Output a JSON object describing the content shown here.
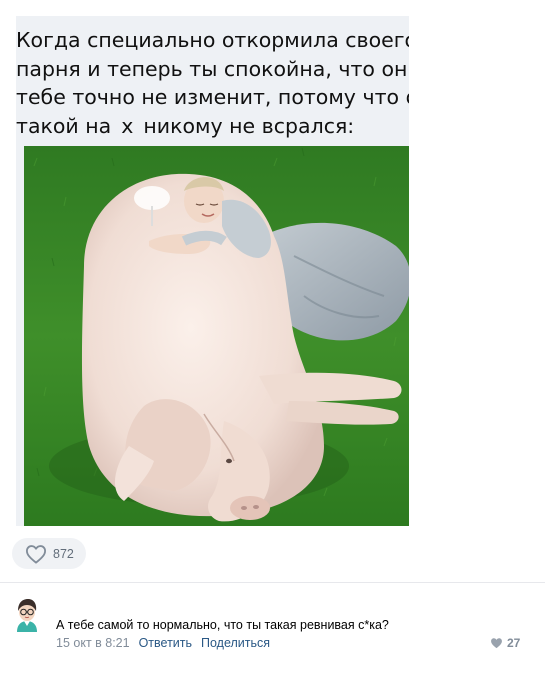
{
  "post": {
    "caption_lines": [
      "Когда специально откормила своего",
      "парня и теперь ты спокойна, что он",
      "тебе точно не изменит, потому что он"
    ],
    "caption_last_start": "такой на",
    "caption_last_word": "х",
    "caption_last_end": "никому не всрался:",
    "photo_icon": "woman-hugging-pig-photo",
    "like_icon": "heart-outline-icon",
    "likes": "872"
  },
  "comment": {
    "avatar_icon": "cartoon-avatar-icon",
    "text": "А тебе самой то нормально, что ты такая ревнивая с*ка?",
    "date": "15 окт в 8:21",
    "reply_label": "Ответить",
    "share_label": "Поделиться",
    "like_icon": "heart-filled-icon",
    "likes": "27"
  },
  "colors": {
    "link": "#2a5885",
    "meta": "#818c99",
    "pill_bg": "#f0f2f5",
    "grass": "#3f8f2a"
  }
}
